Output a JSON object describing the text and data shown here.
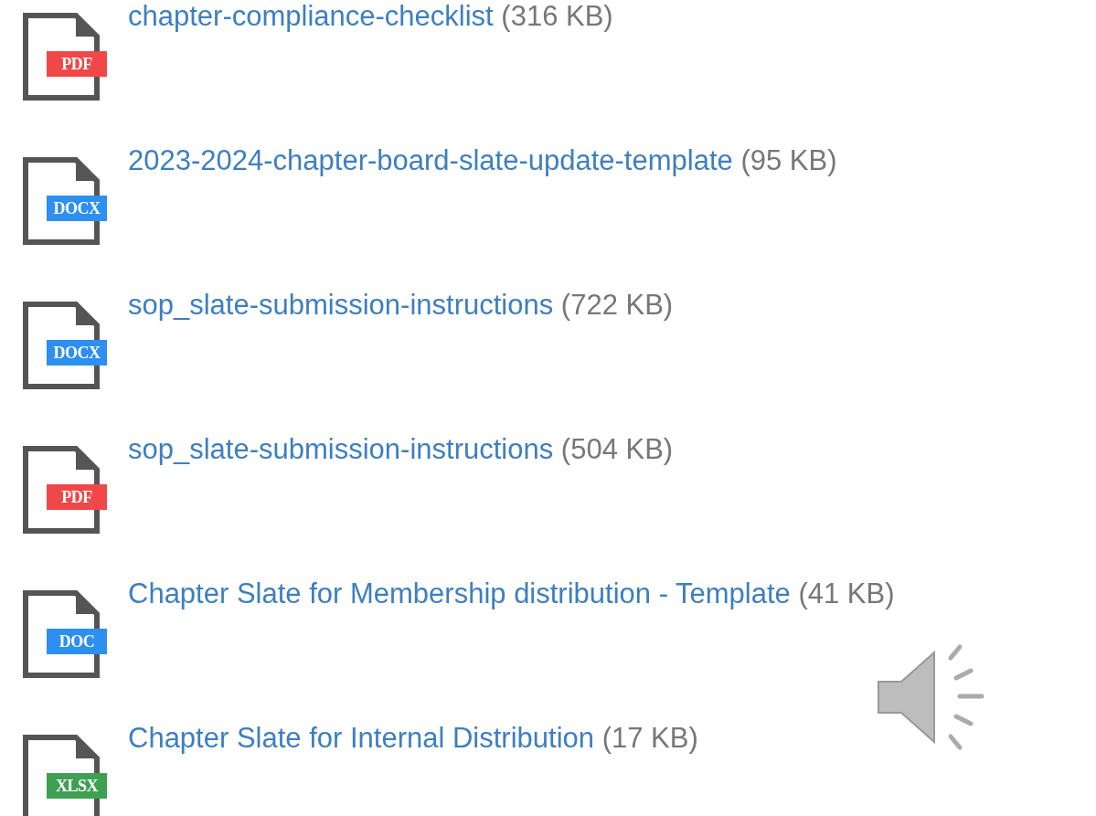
{
  "files": [
    {
      "name": "chapter-compliance-checklist",
      "size": "(316 KB)",
      "badge": "PDF",
      "color": "#f04848"
    },
    {
      "name": "2023-2024-chapter-board-slate-update-template",
      "size": "(95 KB)",
      "badge": "DOCX",
      "color": "#2d8ff0"
    },
    {
      "name": "sop_slate-submission-instructions",
      "size": "(722 KB)",
      "badge": "DOCX",
      "color": "#2d8ff0"
    },
    {
      "name": "sop_slate-submission-instructions",
      "size": "(504 KB)",
      "badge": "PDF",
      "color": "#f04848"
    },
    {
      "name": "Chapter Slate for Membership distribution - Template",
      "size": "(41 KB)",
      "badge": "DOC",
      "color": "#2d8ff0"
    },
    {
      "name": "Chapter Slate for Internal Distribution",
      "size": "(17 KB)",
      "badge": "XLSX",
      "color": "#3ea052"
    }
  ]
}
